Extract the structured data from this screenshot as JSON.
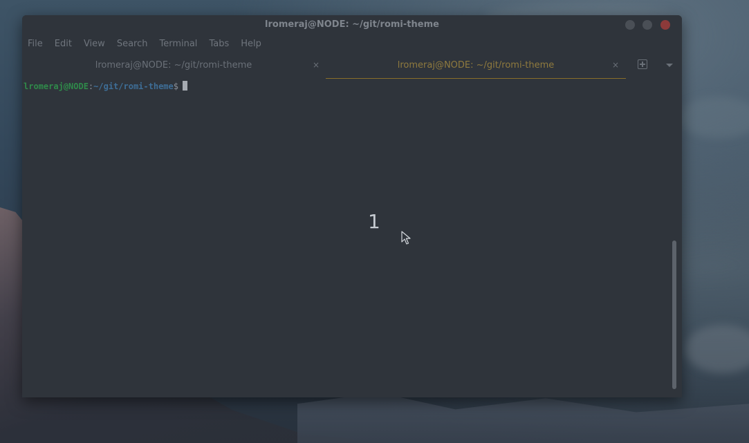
{
  "window": {
    "title": "lromeraj@NODE: ~/git/romi-theme"
  },
  "menu": [
    "File",
    "Edit",
    "View",
    "Search",
    "Terminal",
    "Tabs",
    "Help"
  ],
  "tabs": [
    {
      "label": "lromeraj@NODE: ~/git/romi-theme",
      "close": "×",
      "active": false
    },
    {
      "label": "lromeraj@NODE: ~/git/romi-theme",
      "close": "×",
      "active": true
    }
  ],
  "terminal": {
    "user_host": "lromeraj@NODE",
    "separator": ":",
    "path": "~/git/romi-theme",
    "dollar": "$"
  },
  "overlay": {
    "number": "1"
  },
  "icons": {
    "new_tab": "new-tab-icon",
    "tabs_menu": "chevron-down-icon",
    "pointer": "mouse-pointer-icon"
  }
}
